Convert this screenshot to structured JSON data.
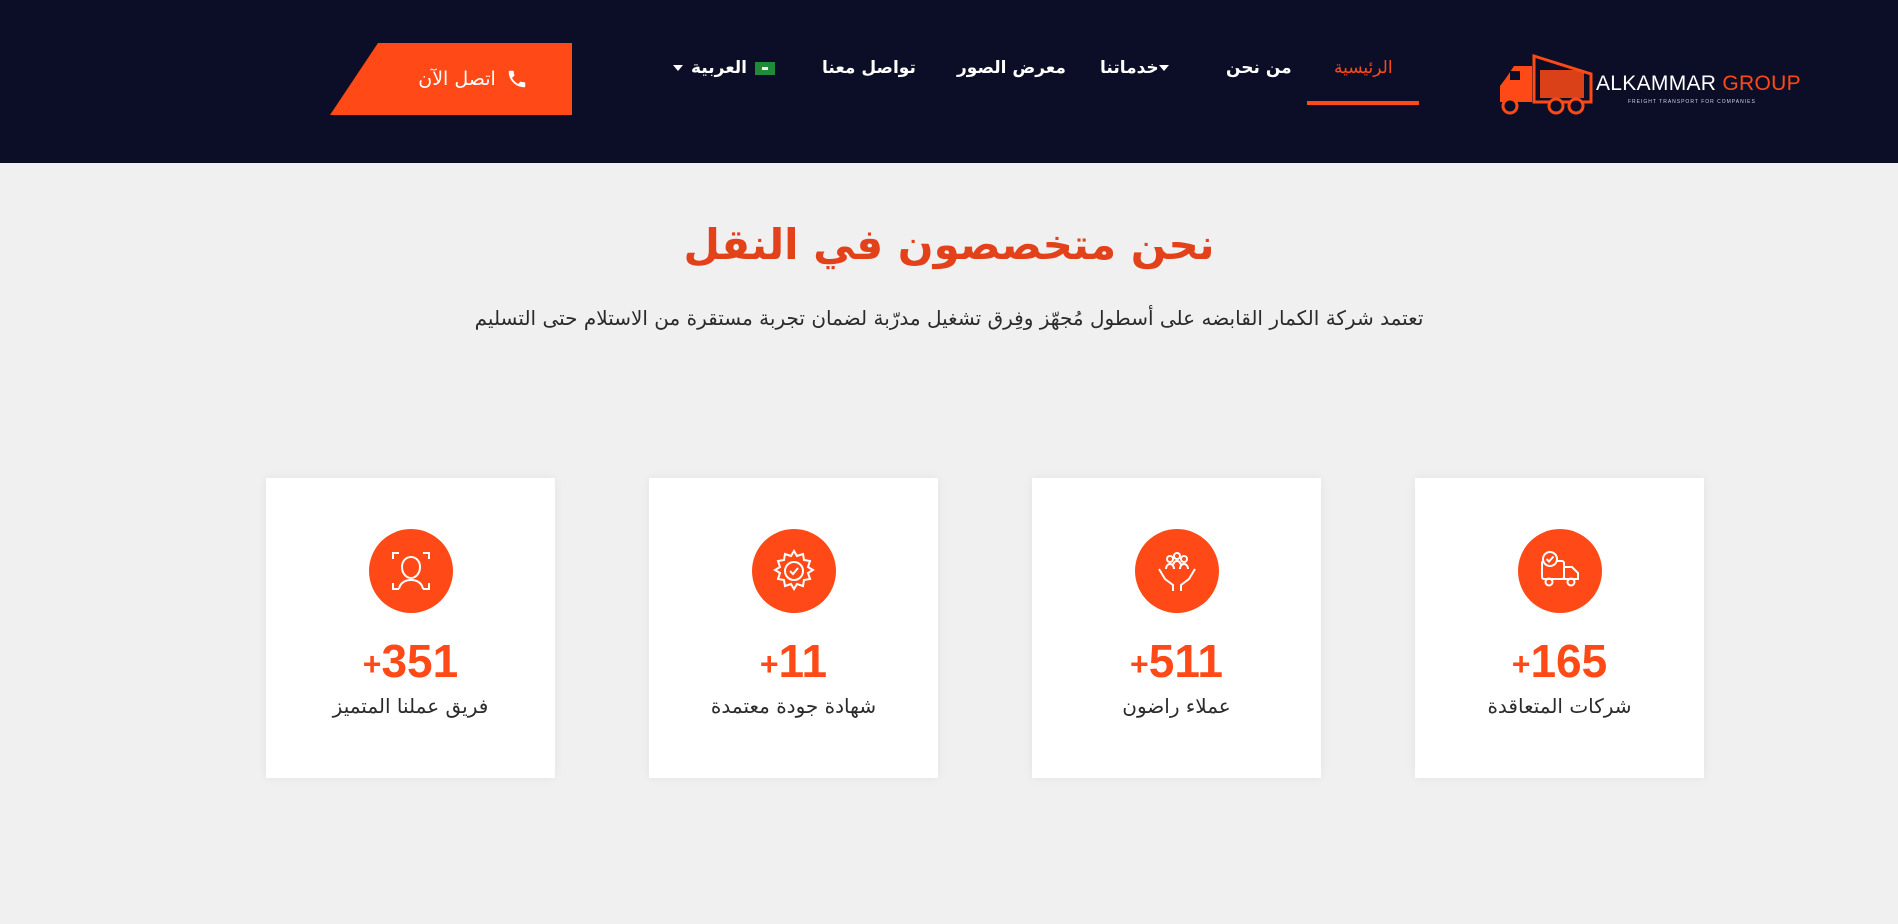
{
  "brand": {
    "name_main": "ALKAMMAR ",
    "name_accent": "GROUP",
    "tagline": "FREIGHT TRANSPORT FOR COMPANIES",
    "accent_color": "#ff4a17",
    "header_color": "#0b0e26"
  },
  "nav": {
    "home": "الرئيسية",
    "about": "من نحن",
    "services": "خدماتنا",
    "gallery": "معرض الصور",
    "contact": "تواصل معنا",
    "language": "العربية"
  },
  "cta": {
    "label": "اتصل الآن",
    "icon": "phone-icon"
  },
  "section": {
    "title": "نحن متخصصون في النقل",
    "subtitle": "تعتمد شركة الكمار القابضه على أسطول مُجهّز وفِرق تشغيل مدرّبة لضمان تجربة مستقرة من الاستلام حتى التسليم"
  },
  "stats": [
    {
      "number": "165",
      "plus": "+",
      "label": "شركات المتعاقدة",
      "icon": "truck-check-icon"
    },
    {
      "number": "511",
      "plus": "+",
      "label": "عملاء راضون",
      "icon": "hands-people-icon"
    },
    {
      "number": "11",
      "plus": "+",
      "label": "شهادة جودة معتمدة",
      "icon": "gear-check-icon"
    },
    {
      "number": "351",
      "plus": "+",
      "label": "فريق عملنا المتميز",
      "icon": "face-scan-icon"
    }
  ]
}
